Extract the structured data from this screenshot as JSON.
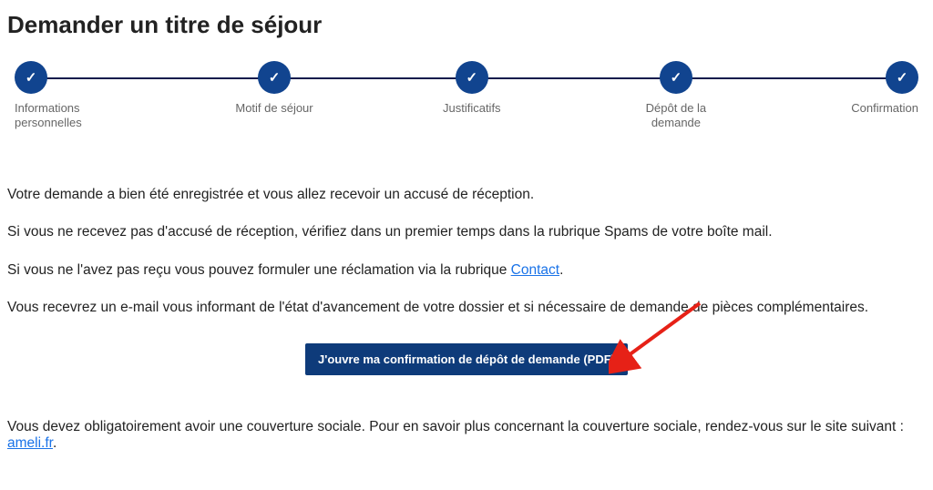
{
  "page": {
    "title": "Demander un titre de séjour"
  },
  "stepper": {
    "steps": [
      {
        "label": "Informations personnelles"
      },
      {
        "label": "Motif de séjour"
      },
      {
        "label": "Justificatifs"
      },
      {
        "label": "Dépôt de la demande"
      },
      {
        "label": "Confirmation"
      }
    ]
  },
  "confirmation": {
    "p1": "Votre demande a bien été enregistrée et vous allez recevoir un accusé de réception.",
    "p2": "Si vous ne recevez pas d'accusé de réception, vérifiez dans un premier temps dans la rubrique Spams de votre boîte mail.",
    "p3_pre": "Si vous ne l'avez pas reçu vous pouvez formuler une réclamation via la rubrique ",
    "p3_link": "Contact",
    "p3_post": ".",
    "p4": "Vous recevrez un e-mail vous informant de l'état d'avancement de votre dossier et si nécessaire de demande de pièces complémentaires."
  },
  "actions": {
    "open_pdf": "J'ouvre ma confirmation de dépôt de demande (PDF)"
  },
  "footer": {
    "pre": "Vous devez obligatoirement avoir une couverture sociale. Pour en savoir plus concernant la couverture sociale, rendez-vous sur le site suivant : ",
    "link": "ameli.fr",
    "post": "."
  }
}
